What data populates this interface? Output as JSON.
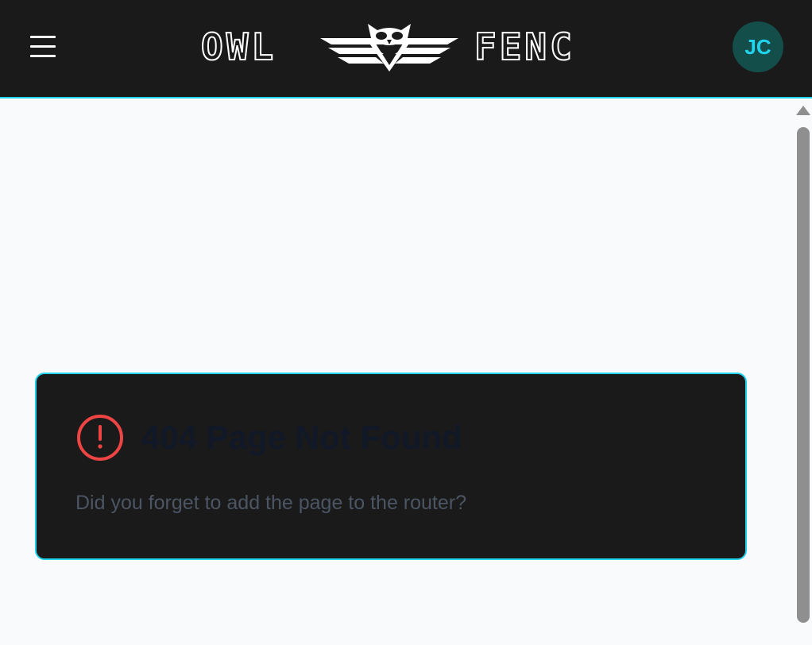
{
  "header": {
    "menu_icon": "hamburger-menu-icon",
    "logo": {
      "left_text": "OWL",
      "right_text": "FENC",
      "emblem_icon": "owl-wings-icon"
    },
    "avatar_initials": "JC"
  },
  "error_card": {
    "icon": "alert-circle-icon",
    "title": "404 Page Not Found",
    "message": "Did you forget to add the page to the router?"
  },
  "colors": {
    "header_bg": "#1a1a1a",
    "accent": "#22d3ee",
    "avatar_bg": "#134e4a",
    "error_icon": "#ef4444",
    "page_bg": "#f8fafc",
    "card_bg": "#1a1a1a"
  }
}
